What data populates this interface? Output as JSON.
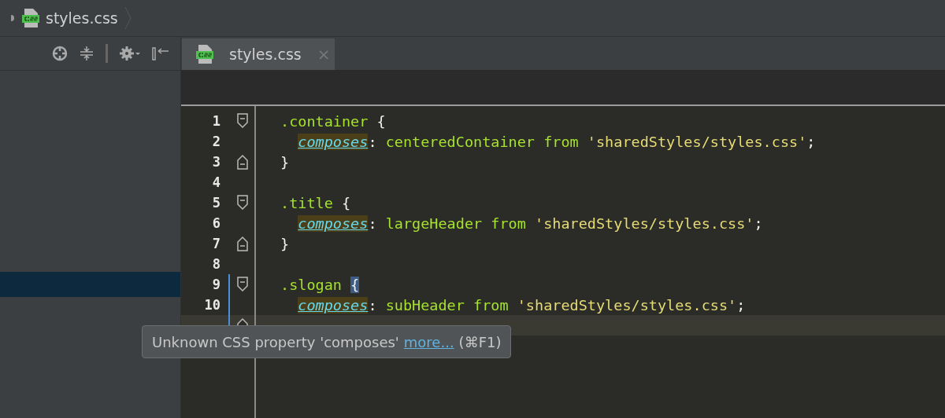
{
  "breadcrumb": {
    "file": "styles.css"
  },
  "tab": {
    "label": "styles.css",
    "selected": true,
    "close": "×"
  },
  "sidebar": {
    "rows": [
      {
        "selected": true
      }
    ]
  },
  "lines": [
    {
      "number": "1",
      "fold_open": true,
      "current": false,
      "tokens": [
        {
          "kind": "selector",
          "text": ".container"
        },
        {
          "kind": "plain",
          "text": " {"
        }
      ]
    },
    {
      "number": "2",
      "current": false,
      "tokens": [
        {
          "kind": "property",
          "text": "composes"
        },
        {
          "kind": "plain",
          "text": ": "
        },
        {
          "kind": "value",
          "text": "centeredContainer from "
        },
        {
          "kind": "string",
          "text": "'sharedStyles/styles.css'"
        },
        {
          "kind": "plain",
          "text": ";"
        }
      ]
    },
    {
      "number": "3",
      "fold_close": true,
      "current": false,
      "tokens": [
        {
          "kind": "plain",
          "text": "}"
        }
      ]
    },
    {
      "number": "4",
      "current": false
    },
    {
      "number": "5",
      "fold_open": true,
      "current": false,
      "tokens": [
        {
          "kind": "selector",
          "text": ".title"
        },
        {
          "kind": "plain",
          "text": " {"
        }
      ]
    },
    {
      "number": "6",
      "current": false,
      "tokens": [
        {
          "kind": "property",
          "text": "composes"
        },
        {
          "kind": "plain",
          "text": ": "
        },
        {
          "kind": "value",
          "text": "largeHeader from "
        },
        {
          "kind": "string",
          "text": "'sharedStyles/styles.css'"
        },
        {
          "kind": "plain",
          "text": ";"
        }
      ]
    },
    {
      "number": "7",
      "fold_close": true,
      "current": false,
      "tokens": [
        {
          "kind": "plain",
          "text": "}"
        }
      ]
    },
    {
      "number": "8",
      "current": false
    },
    {
      "number": "9",
      "fold_open": true,
      "scope": true,
      "current": false,
      "tokens": [
        {
          "kind": "selector",
          "text": ".slogan"
        },
        {
          "kind": "matched",
          "text": "{"
        }
      ]
    },
    {
      "number": "10",
      "scope": true,
      "current": false,
      "tokens": [
        {
          "kind": "property",
          "text": "composes"
        },
        {
          "kind": "plain",
          "text": ": "
        },
        {
          "kind": "value",
          "text": "subHeader from "
        },
        {
          "kind": "string",
          "text": "'sharedStyles/styles.css'"
        },
        {
          "kind": "plain",
          "text": ";"
        }
      ]
    },
    {
      "fold_close": true,
      "scope": true,
      "current": true
    }
  ],
  "tooltip": {
    "text": "Unknown CSS property 'composes'",
    "link": "more...",
    "shortcut": "(⌘F1)"
  }
}
